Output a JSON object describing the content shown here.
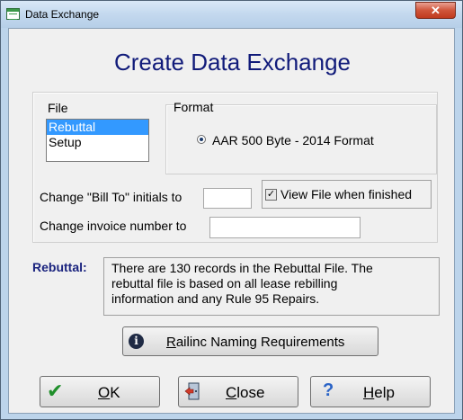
{
  "window": {
    "title": "Data Exchange",
    "close_glyph": "✕"
  },
  "heading": "Create Data Exchange",
  "file_group": {
    "label": "File",
    "items": [
      "Rebuttal",
      "Setup"
    ],
    "selected": "Rebuttal"
  },
  "format_group": {
    "label": "Format",
    "option": "AAR 500 Byte - 2014 Format",
    "selected": true
  },
  "bill_to": {
    "label": "Change \"Bill To\" initials to",
    "value": ""
  },
  "invoice": {
    "label": "Change invoice number to",
    "value": ""
  },
  "view_file": {
    "label": "View File when finished",
    "checked": true,
    "check_glyph": "✓"
  },
  "rebuttal": {
    "label": "Rebuttal:",
    "lines": [
      "There are 130 records in the Rebuttal File.  The",
      "rebuttal file is based on all lease rebilling",
      "information and any Rule 95 Repairs."
    ]
  },
  "naming_button": {
    "icon": "info-icon",
    "glyph": "i",
    "mnemonic": "R",
    "rest": "ailinc Naming Requirements"
  },
  "ok_button": {
    "icon": "check-icon",
    "glyph": "✔",
    "mnemonic": "O",
    "rest": "K"
  },
  "close_button": {
    "icon": "close-door-icon",
    "mnemonic": "C",
    "rest": "lose"
  },
  "help_button": {
    "icon": "help-icon",
    "glyph": "?",
    "mnemonic": "H",
    "rest": "elp"
  },
  "colors": {
    "title_blue": "#111b7a",
    "selection": "#3399ff",
    "close_red": "#c03a1e"
  }
}
